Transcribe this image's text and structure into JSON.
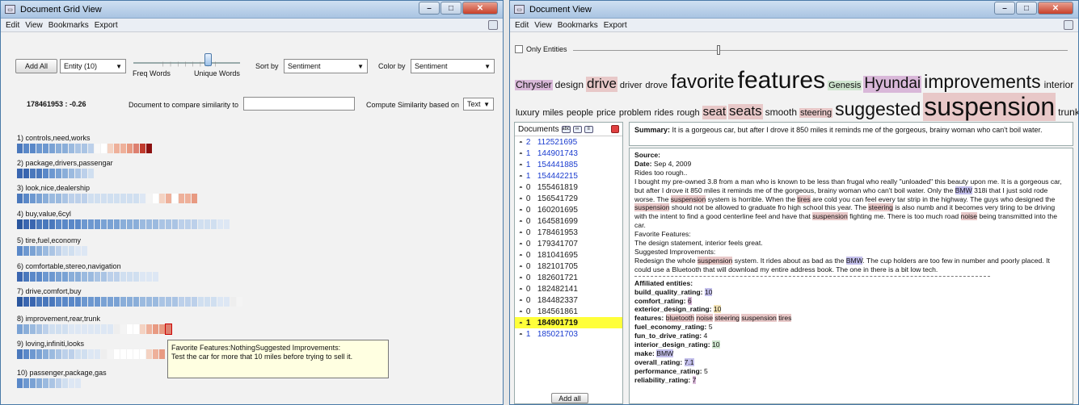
{
  "grid": {
    "title": "Document Grid View",
    "menus": [
      "Edit",
      "View",
      "Bookmarks",
      "Export"
    ],
    "add_all": "Add All",
    "entity_dd": "Entity (10)",
    "slider_left": "Freq Words",
    "slider_right": "Unique Words",
    "sort_label": "Sort by",
    "sort_value": "Sentiment",
    "color_label": "Color by",
    "color_value": "Sentiment",
    "doc_score": "178461953 : -0.26",
    "compare_label": "Document to compare similarity to",
    "compare_value": "",
    "compute_label": "Compute Similarity based on",
    "compute_value": "Text",
    "topics": [
      {
        "label": "1) controls,need,works",
        "cells": [
          "#4a78bc",
          "#5a88c8",
          "#5a88c8",
          "#6d98d0",
          "#6d98d0",
          "#7aa2d4",
          "#8aaed9",
          "#8aaed9",
          "#9bbadf",
          "#aac4e4",
          "#aac4e4",
          "#bcd0ea",
          "#f8f8f8",
          "#ffffff",
          "#f4d2c2",
          "#eeb09a",
          "#eeb09a",
          "#e89a82",
          "#dd8070",
          "#c03b2e",
          "#8c1010"
        ]
      },
      {
        "label": "2) package,drivers,passengar",
        "cells": [
          "#3a66b0",
          "#3a66b0",
          "#4a78bc",
          "#4a78bc",
          "#5a88c8",
          "#6d98d0",
          "#7aa2d4",
          "#8aaed9",
          "#9bbadf",
          "#aac4e4",
          "#bcd0ea",
          "#d0dff0"
        ]
      },
      {
        "label": "3) look,nice,dealership",
        "cells": [
          "#4a78bc",
          "#5a88c8",
          "#6d98d0",
          "#7aa2d4",
          "#8aaed9",
          "#9bbadf",
          "#9bbadf",
          "#aac4e4",
          "#bcd0ea",
          "#bcd0ea",
          "#bcd0ea",
          "#d0dff0",
          "#d0dff0",
          "#d0dff0",
          "#d0dff0",
          "#d0dff0",
          "#d0dff0",
          "#d0dff0",
          "#d0dff0",
          "#dde7f4",
          "#f4f4f4",
          "#ffffff",
          "#f4d2c2",
          "#eeb09a",
          "#ffffff",
          "#eeb09a",
          "#eeb09a",
          "#e89a82"
        ]
      },
      {
        "label": "4) buy,value,6cyl",
        "cells": [
          "#2a569e",
          "#3a66b0",
          "#3a66b0",
          "#4a78bc",
          "#4a78bc",
          "#4a78bc",
          "#5a88c8",
          "#5a88c8",
          "#5a88c8",
          "#5a88c8",
          "#6d98d0",
          "#6d98d0",
          "#6d98d0",
          "#7aa2d4",
          "#7aa2d4",
          "#7aa2d4",
          "#8aaed9",
          "#8aaed9",
          "#8aaed9",
          "#9bbadf",
          "#9bbadf",
          "#9bbadf",
          "#aac4e4",
          "#aac4e4",
          "#aac4e4",
          "#bcd0ea",
          "#bcd0ea",
          "#bcd0ea",
          "#d0dff0",
          "#d0dff0",
          "#d0dff0",
          "#dde7f4",
          "#dde7f4"
        ]
      },
      {
        "label": "5) tire,fuel,economy",
        "cells": [
          "#5a88c8",
          "#6d98d0",
          "#7aa2d4",
          "#8aaed9",
          "#9bbadf",
          "#aac4e4",
          "#bcd0ea",
          "#d0dff0",
          "#d0dff0",
          "#dde7f4",
          "#dde7f4"
        ]
      },
      {
        "label": "6) comfortable,stereo,navigation",
        "cells": [
          "#3a66b0",
          "#4a78bc",
          "#5a88c8",
          "#5a88c8",
          "#6d98d0",
          "#6d98d0",
          "#7aa2d4",
          "#7aa2d4",
          "#8aaed9",
          "#8aaed9",
          "#9bbadf",
          "#9bbadf",
          "#aac4e4",
          "#aac4e4",
          "#bcd0ea",
          "#bcd0ea",
          "#d0dff0",
          "#d0dff0",
          "#d0dff0",
          "#dde7f4",
          "#dde7f4",
          "#dde7f4"
        ]
      },
      {
        "label": "7) drive,comfort,buy",
        "cells": [
          "#2a569e",
          "#3a66b0",
          "#3a66b0",
          "#4a78bc",
          "#4a78bc",
          "#4a78bc",
          "#5a88c8",
          "#5a88c8",
          "#5a88c8",
          "#5a88c8",
          "#6d98d0",
          "#6d98d0",
          "#6d98d0",
          "#7aa2d4",
          "#7aa2d4",
          "#7aa2d4",
          "#8aaed9",
          "#8aaed9",
          "#8aaed9",
          "#9bbadf",
          "#9bbadf",
          "#9bbadf",
          "#aac4e4",
          "#aac4e4",
          "#aac4e4",
          "#bcd0ea",
          "#bcd0ea",
          "#bcd0ea",
          "#d0dff0",
          "#d0dff0",
          "#d0dff0",
          "#dde7f4",
          "#dde7f4",
          "#eeeeee",
          "#f4f4f4"
        ]
      },
      {
        "label": "8) improvement,rear,trunk",
        "cells": [
          "#7aa2d4",
          "#8aaed9",
          "#9bbadf",
          "#aac4e4",
          "#bcd0ea",
          "#d0dff0",
          "#d0dff0",
          "#d0dff0",
          "#dde7f4",
          "#dde7f4",
          "#dde7f4",
          "#dde7f4",
          "#dde7f4",
          "#dde7f4",
          "#dde7f4",
          "#eeeeee",
          "#f4f4f4",
          "#ffffff",
          "#ffffff",
          "#f4d2c2",
          "#eeb09a",
          "#e89a82",
          "#e89a82",
          "#dd8070"
        ]
      },
      {
        "label": "9) loving,infiniti,looks",
        "cells": [
          "#4a78bc",
          "#5a88c8",
          "#6d98d0",
          "#7aa2d4",
          "#8aaed9",
          "#9bbadf",
          "#aac4e4",
          "#bcd0ea",
          "#bcd0ea",
          "#d0dff0",
          "#d0dff0",
          "#dde7f4",
          "#dde7f4",
          "#eeeeee",
          "#f4f4f4",
          "#ffffff",
          "#ffffff",
          "#ffffff",
          "#ffffff",
          "#ffffff",
          "#f4d2c2",
          "#eeb09a",
          "#e89a82"
        ]
      },
      {
        "label": "10) passenger,package,gas",
        "cells": [
          "#5a88c8",
          "#6d98d0",
          "#7aa2d4",
          "#8aaed9",
          "#9bbadf",
          "#aac4e4",
          "#bcd0ea",
          "#d0dff0",
          "#dde7f4",
          "#dde7f4"
        ]
      }
    ],
    "tooltip_line1": "Favorite Features:NothingSuggested Improvements:",
    "tooltip_line2": "Test the car for more that 10 miles before trying to sell it."
  },
  "view": {
    "title": "Document View",
    "menus": [
      "Edit",
      "View",
      "Bookmarks",
      "Export"
    ],
    "only_entities": "Only Entities",
    "cloud_row1": [
      {
        "w": "Chrysler",
        "s": 12,
        "bg": "#d9b8d9"
      },
      {
        "w": "design",
        "s": 12,
        "bg": ""
      },
      {
        "w": "drive",
        "s": 17,
        "bg": "#e8c8c8"
      },
      {
        "w": "driver",
        "s": 11,
        "bg": ""
      },
      {
        "w": "drove",
        "s": 11,
        "bg": ""
      },
      {
        "w": "favorite",
        "s": 24,
        "bg": ""
      },
      {
        "w": "features",
        "s": 30,
        "bg": ""
      },
      {
        "w": "Genesis",
        "s": 11,
        "bg": "#cfe6cf"
      },
      {
        "w": "Hyundai",
        "s": 19,
        "bg": "#d9b8d9"
      },
      {
        "w": "improvements",
        "s": 23,
        "bg": ""
      },
      {
        "w": "interior",
        "s": 12,
        "bg": ""
      }
    ],
    "cloud_row2": [
      {
        "w": "luxury",
        "s": 11,
        "bg": ""
      },
      {
        "w": "miles",
        "s": 11,
        "bg": ""
      },
      {
        "w": "people",
        "s": 11,
        "bg": ""
      },
      {
        "w": "price",
        "s": 11,
        "bg": ""
      },
      {
        "w": "problem",
        "s": 11,
        "bg": ""
      },
      {
        "w": "rides",
        "s": 11,
        "bg": ""
      },
      {
        "w": "rough",
        "s": 11,
        "bg": ""
      },
      {
        "w": "seat",
        "s": 15,
        "bg": "#e8c8c8"
      },
      {
        "w": "seats",
        "s": 17,
        "bg": "#e8c8c8"
      },
      {
        "w": "smooth",
        "s": 12,
        "bg": ""
      },
      {
        "w": "steering",
        "s": 11,
        "bg": "#e8c8c8"
      },
      {
        "w": "suggested",
        "s": 23,
        "bg": ""
      },
      {
        "w": "suspension",
        "s": 32,
        "bg": "#e8c8c8"
      },
      {
        "w": "trunk",
        "s": 12,
        "bg": ""
      }
    ],
    "docs_label": "Documents",
    "docs": [
      {
        "c": "2",
        "id": "112521695"
      },
      {
        "c": "1",
        "id": "144901743"
      },
      {
        "c": "1",
        "id": "154441885"
      },
      {
        "c": "1",
        "id": "154442215"
      },
      {
        "c": "0",
        "id": "155461819"
      },
      {
        "c": "0",
        "id": "156541729"
      },
      {
        "c": "0",
        "id": "160201695"
      },
      {
        "c": "0",
        "id": "164581699"
      },
      {
        "c": "0",
        "id": "178461953"
      },
      {
        "c": "0",
        "id": "179341707"
      },
      {
        "c": "0",
        "id": "181041695"
      },
      {
        "c": "0",
        "id": "182101705"
      },
      {
        "c": "0",
        "id": "182601721"
      },
      {
        "c": "0",
        "id": "182482141"
      },
      {
        "c": "0",
        "id": "184482337"
      },
      {
        "c": "0",
        "id": "184561861"
      },
      {
        "c": "1",
        "id": "184901719",
        "sel": true
      },
      {
        "c": "1",
        "id": "185021703"
      }
    ],
    "add_all": "Add all",
    "summary_label": "Summary:",
    "summary_text": "It is a gorgeous car, but after I drove it 850 miles it reminds me of the gorgeous, brainy woman who can't boil water."
  }
}
